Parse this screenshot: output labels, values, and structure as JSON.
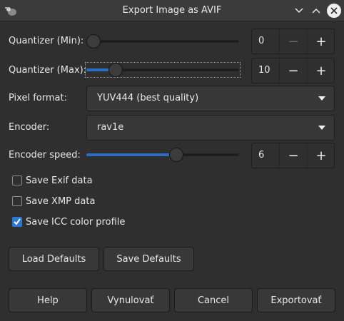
{
  "window": {
    "title": "Export Image as AVIF",
    "controls": [
      "minimize-icon",
      "maximize-icon",
      "close-icon"
    ]
  },
  "quantizer_min": {
    "label": "Quantizer (Min):",
    "value": "0",
    "slider_fraction": 0.0,
    "decrement_enabled": false
  },
  "quantizer_max": {
    "label": "Quantizer (Max):",
    "value": "10",
    "slider_fraction": 0.16
  },
  "pixel_format": {
    "label": "Pixel format:",
    "value": "YUV444 (best quality)"
  },
  "encoder": {
    "label": "Encoder:",
    "value": "rav1e"
  },
  "encoder_speed": {
    "label": "Encoder speed:",
    "value": "6",
    "slider_fraction": 0.6
  },
  "options": [
    {
      "label": "Save Exif data",
      "checked": false
    },
    {
      "label": "Save XMP data",
      "checked": false
    },
    {
      "label": "Save ICC color profile",
      "checked": true
    }
  ],
  "defaults_buttons": {
    "load": "Load Defaults",
    "save": "Save Defaults"
  },
  "dialog_buttons": {
    "help": "Help",
    "reset": "Vynulovať",
    "cancel": "Cancel",
    "export": "Exportovať"
  },
  "colors": {
    "accent": "#2a77d6",
    "background": "#2f2f2f",
    "titlebar": "#3b3b3b"
  }
}
